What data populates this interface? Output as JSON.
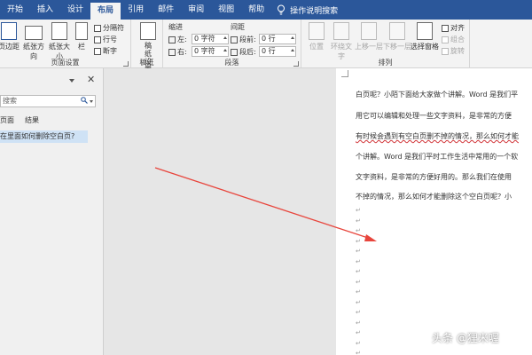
{
  "tabs": [
    {
      "label": "开始"
    },
    {
      "label": "插入"
    },
    {
      "label": "设计"
    },
    {
      "label": "布局"
    },
    {
      "label": "引用"
    },
    {
      "label": "邮件"
    },
    {
      "label": "审阅"
    },
    {
      "label": "视图"
    },
    {
      "label": "帮助"
    }
  ],
  "tell_me": "操作说明搜索",
  "ribbon": {
    "page_setup": {
      "margins": "页边距",
      "orientation": "纸张方向",
      "size": "纸张大小",
      "columns": "栏",
      "breaks": "分隔符",
      "line_numbers": "行号",
      "hyphenation": "断字",
      "label": "页面设置"
    },
    "draft": {
      "button": "稿纸设置",
      "label": "稿纸"
    },
    "paragraph": {
      "indent_title": "缩进",
      "spacing_title": "间距",
      "left_label": "左:",
      "right_label": "右:",
      "before_label": "段前:",
      "after_label": "段后:",
      "left_value": "0 字符",
      "right_value": "0 字符",
      "before_value": "0 行",
      "after_value": "0 行",
      "label": "段落"
    },
    "arrange": {
      "position": "位置",
      "wrap": "环绕文字",
      "forward": "上移一层",
      "backward": "下移一层",
      "selection_pane": "选择窗格",
      "align": "对齐",
      "group": "组合",
      "rotate": "旋转",
      "label": "排列"
    }
  },
  "nav": {
    "search_placeholder": "搜索",
    "tab_pages": "页面",
    "tab_results": "结果",
    "result": "在里面如何删除空白页?"
  },
  "document": {
    "lines": [
      "白页呢？小陌下面给大家做个讲解。Word 是我们平",
      "用它可以编辑和处理一些文字资料，是非常的方便",
      "有时候会遇到有空白页删不掉的情况，那么如何才能",
      "个讲解。Word 是我们平时工作生活中常用的一个软",
      "文字资料，是非常的方便好用的。那么我们在使用",
      "不掉的情况，那么如何才能删除这个空白页呢？小"
    ],
    "paragraph_mark": "↵"
  },
  "watermark": "头条 @狸米喔",
  "colors": {
    "accent": "#2b579a",
    "arrow": "#e8453c"
  }
}
